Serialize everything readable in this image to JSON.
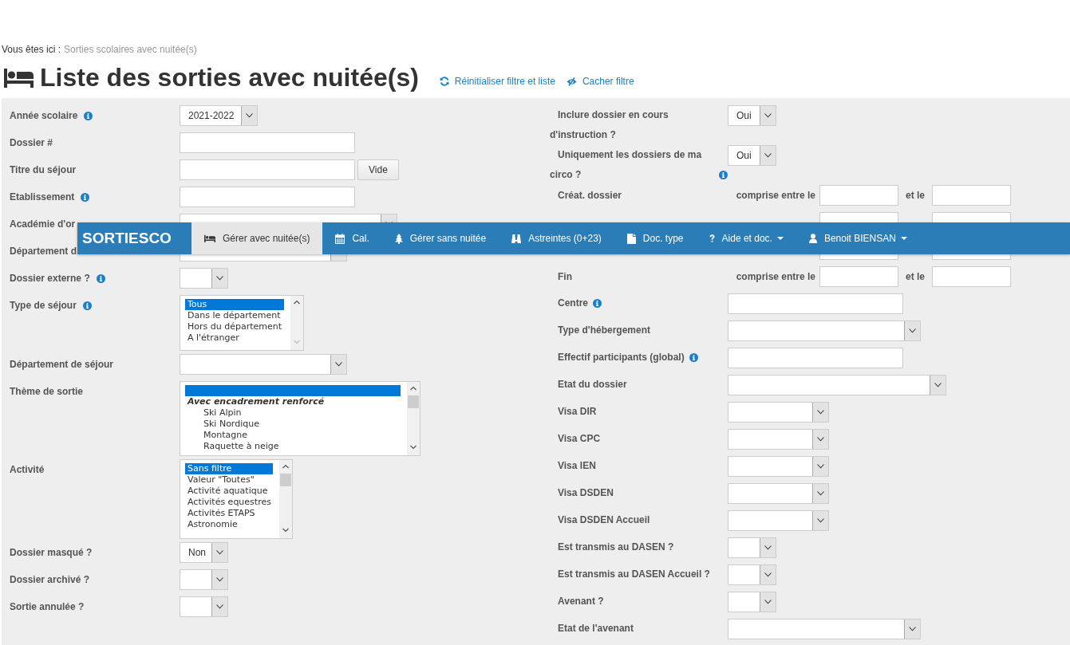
{
  "breadcrumb": {
    "prefix": "Vous êtes ici :",
    "current": "Sorties scolaires avec nuitée(s)"
  },
  "title": "Liste des sorties avec nuitée(s)",
  "title_links": [
    {
      "label": "Réinitialiser filtre et liste"
    },
    {
      "label": "Cacher filtre"
    }
  ],
  "filters_left": [
    {
      "kind": "select",
      "label": "Année scolaire",
      "info": true,
      "value": "2021-2022"
    },
    {
      "kind": "input",
      "label": "Dossier #",
      "info": false
    },
    {
      "kind": "input",
      "label": "Titre du séjour",
      "info": false,
      "button": "Vide"
    },
    {
      "kind": "input",
      "label": "Etablissement",
      "info": true
    },
    {
      "kind": "select",
      "label": "Académie d'or",
      "info": false
    },
    {
      "kind": "select",
      "label": "Département d",
      "info": false
    },
    {
      "kind": "select",
      "label": "Dossier externe ?",
      "info": true
    },
    {
      "kind": "listbox",
      "label": "Type de séjour",
      "info": true,
      "options": [
        {
          "kind": "option",
          "label": "Tous",
          "selected": true
        },
        {
          "kind": "option",
          "label": "Dans le département",
          "selected": false
        },
        {
          "kind": "option",
          "label": "Hors du département",
          "selected": false
        },
        {
          "kind": "option",
          "label": "A l'étranger",
          "selected": false
        }
      ]
    },
    {
      "kind": "select",
      "label": "Département de séjour",
      "info": false
    },
    {
      "kind": "listbox",
      "label": "Thème de sortie",
      "info": false,
      "options": [
        {
          "kind": "option",
          "selected": true
        },
        {
          "kind": "group",
          "label": "Avec encadrement renforcé",
          "selected": false,
          "children": [
            {
              "kind": "option",
              "label": "Ski Alpin",
              "selected": false
            },
            {
              "kind": "option",
              "label": "Ski Nordique",
              "selected": false
            },
            {
              "kind": "option",
              "label": "Montagne",
              "selected": false
            },
            {
              "kind": "option",
              "label": "Raquette à neige",
              "selected": false
            }
          ]
        }
      ]
    },
    {
      "kind": "listbox",
      "label": "Activité",
      "info": false,
      "options": [
        {
          "kind": "option",
          "label": "Sans filtre",
          "selected": true
        },
        {
          "kind": "option",
          "label": "Valeur \"Toutes\"",
          "selected": false
        },
        {
          "kind": "option",
          "label": "Activité aquatique",
          "selected": false
        },
        {
          "kind": "option",
          "label": "Activités equestres",
          "selected": false
        },
        {
          "kind": "option",
          "label": "Activités ETAPS",
          "selected": false
        },
        {
          "kind": "option",
          "label": "Astronomie",
          "selected": false
        }
      ]
    },
    {
      "kind": "select",
      "label": "Dossier masqué ?",
      "info": false,
      "value": "Non"
    },
    {
      "kind": "select",
      "label": "Dossier archivé ?",
      "info": false
    },
    {
      "kind": "select",
      "label": "Sortie annulée ?",
      "info": false
    }
  ],
  "filters_right": [
    {
      "kind": "select",
      "label": "Inclure dossier en cours d'instruction ?",
      "info": false,
      "value": "Oui"
    },
    {
      "kind": "select",
      "label": "Uniquement les dossiers de ma circo ?",
      "info": true,
      "value": "Oui"
    },
    {
      "kind": "daterange",
      "label": "Créat. dossier",
      "from_label": "comprise entre le",
      "to_label": "et le"
    },
    {
      "kind": "daterange"
    },
    {
      "kind": "daterange"
    },
    {
      "kind": "daterange",
      "label": "Fin",
      "from_label": "comprise entre le",
      "to_label": "et le"
    },
    {
      "kind": "input",
      "label": "Centre",
      "info": true
    },
    {
      "kind": "select",
      "label": "Type d'hébergement",
      "info": false
    },
    {
      "kind": "input",
      "label": "Effectif participants (global)",
      "info": true
    },
    {
      "kind": "select",
      "label": "Etat du dossier",
      "info": false
    },
    {
      "kind": "select",
      "label": "Visa DIR",
      "info": false
    },
    {
      "kind": "select",
      "label": "Visa CPC",
      "info": false
    },
    {
      "kind": "select",
      "label": "Visa IEN",
      "info": false
    },
    {
      "kind": "select",
      "label": "Visa DSDEN",
      "info": false
    },
    {
      "kind": "select",
      "label": "Visa DSDEN Accueil",
      "info": false
    },
    {
      "kind": "select",
      "label": "Est transmis au DASEN ?",
      "info": false
    },
    {
      "kind": "select",
      "label": "Est transmis au DASEN Accueil ?",
      "info": false
    },
    {
      "kind": "select",
      "label": "Avenant ?",
      "info": false
    },
    {
      "kind": "select",
      "label": "Etat de l'avenant",
      "info": false
    }
  ],
  "navbar": {
    "brand": "SORTIESCO",
    "items": [
      {
        "label": "Gérer avec nuitée(s)",
        "selected": true,
        "dropdown": false
      },
      {
        "label": "Cal.",
        "selected": false,
        "dropdown": false
      },
      {
        "label": "Gérer sans nuitée",
        "selected": false,
        "dropdown": false
      },
      {
        "label": "Astreintes (0+23)",
        "selected": false,
        "dropdown": false
      },
      {
        "label": "Doc. type",
        "selected": false,
        "dropdown": false
      },
      {
        "label": "Aide et doc.",
        "selected": false,
        "dropdown": true
      },
      {
        "label": "Benoit BIENSAN",
        "selected": false,
        "dropdown": true
      }
    ]
  }
}
